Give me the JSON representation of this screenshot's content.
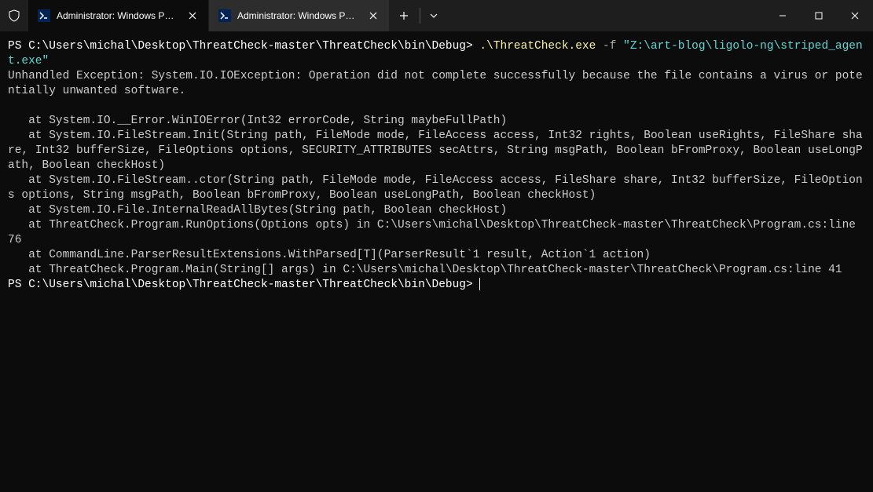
{
  "titlebar": {
    "tabs": [
      {
        "title": "Administrator: Windows Powe",
        "active": true
      },
      {
        "title": "Administrator: Windows Powe",
        "active": false
      }
    ]
  },
  "terminal": {
    "prompt1": "PS C:\\Users\\michal\\Desktop\\ThreatCheck-master\\ThreatCheck\\bin\\Debug> ",
    "command_exe": ".\\ThreatCheck.exe",
    "command_flag": " -f ",
    "command_arg": "\"Z:\\art-blog\\ligolo-ng\\striped_agent.exe\"",
    "output_lines": "\nUnhandled Exception: System.IO.IOException: Operation did not complete successfully because the file contains a virus or potentially unwanted software.\n\n   at System.IO.__Error.WinIOError(Int32 errorCode, String maybeFullPath)\n   at System.IO.FileStream.Init(String path, FileMode mode, FileAccess access, Int32 rights, Boolean useRights, FileShare share, Int32 bufferSize, FileOptions options, SECURITY_ATTRIBUTES secAttrs, String msgPath, Boolean bFromProxy, Boolean useLongPath, Boolean checkHost)\n   at System.IO.FileStream..ctor(String path, FileMode mode, FileAccess access, FileShare share, Int32 bufferSize, FileOptions options, String msgPath, Boolean bFromProxy, Boolean useLongPath, Boolean checkHost)\n   at System.IO.File.InternalReadAllBytes(String path, Boolean checkHost)\n   at ThreatCheck.Program.RunOptions(Options opts) in C:\\Users\\michal\\Desktop\\ThreatCheck-master\\ThreatCheck\\Program.cs:line 76\n   at CommandLine.ParserResultExtensions.WithParsed[T](ParserResult`1 result, Action`1 action)\n   at ThreatCheck.Program.Main(String[] args) in C:\\Users\\michal\\Desktop\\ThreatCheck-master\\ThreatCheck\\Program.cs:line 41",
    "prompt2": "PS C:\\Users\\michal\\Desktop\\ThreatCheck-master\\ThreatCheck\\bin\\Debug> "
  }
}
